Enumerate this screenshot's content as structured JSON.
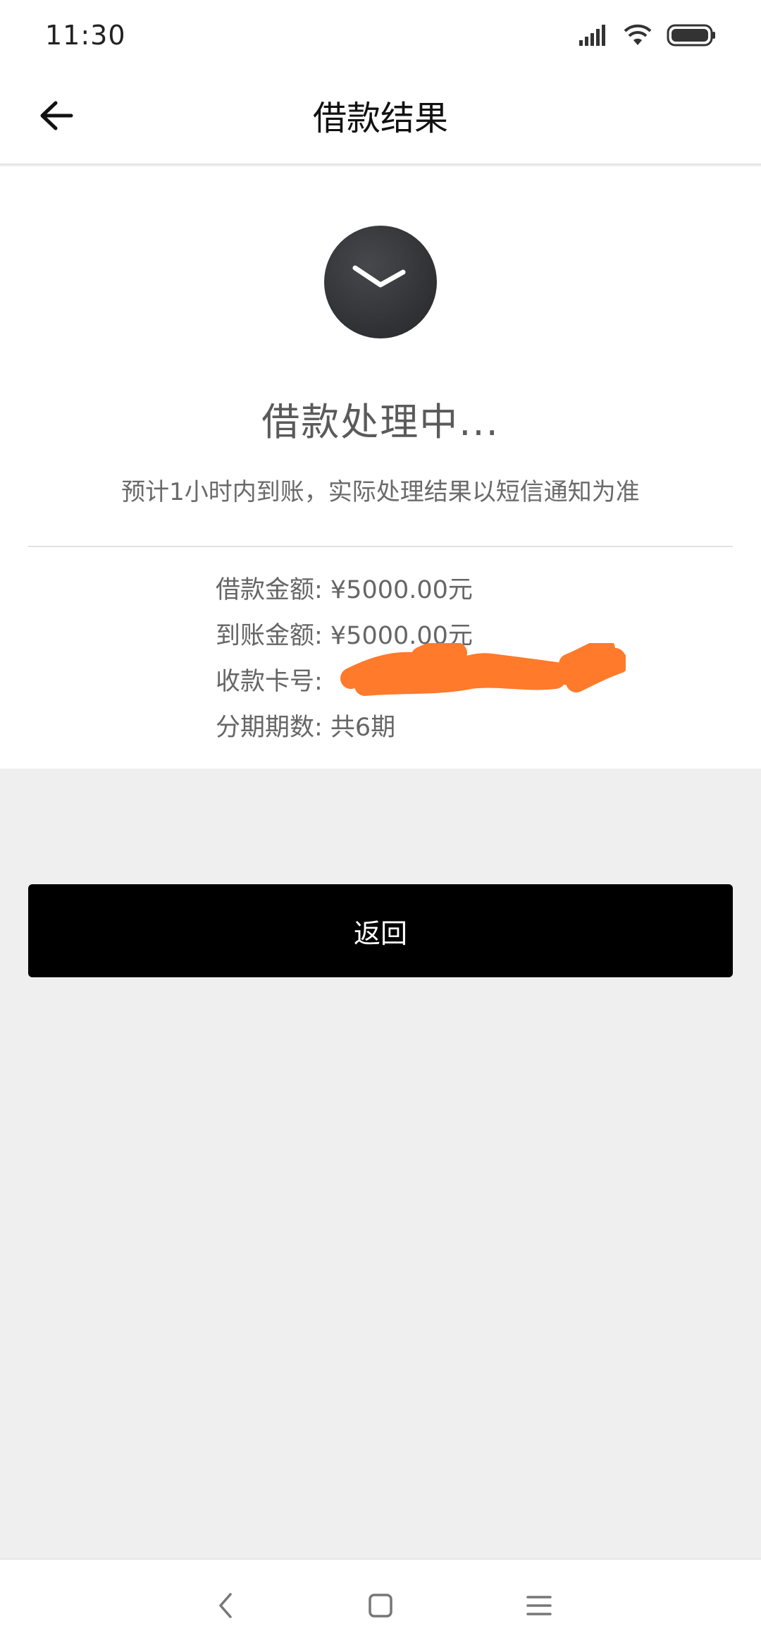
{
  "status_bar": {
    "time": "11:30",
    "icons": [
      "signal-icon",
      "wifi-icon",
      "battery-icon"
    ]
  },
  "header": {
    "title": "借款结果",
    "back_icon": "back-arrow-icon"
  },
  "result": {
    "icon": "clock-icon",
    "title": "借款处理中...",
    "description": "预计1小时内到账，实际处理结果以短信通知为准",
    "details": [
      {
        "text": "借款金额: ¥5000.00元"
      },
      {
        "text": "到账金额: ¥5000.00元"
      },
      {
        "text": "收款卡号: "
      },
      {
        "text": "分期期数: 共6期"
      }
    ]
  },
  "actions": {
    "return_label": "返回"
  },
  "system_nav": {
    "icons": [
      "back-chevron-icon",
      "home-square-icon",
      "menu-lines-icon"
    ]
  },
  "colors": {
    "primary_button": "#000000",
    "redaction": "#ff7a2b",
    "page_background": "#efefef"
  }
}
